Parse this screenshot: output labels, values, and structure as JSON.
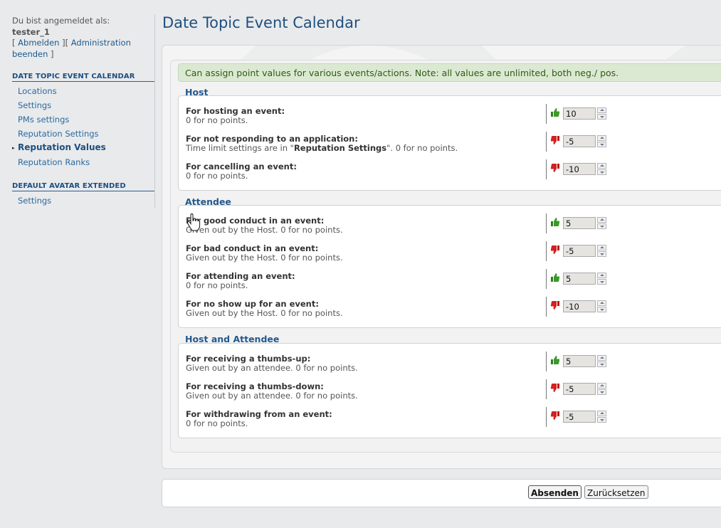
{
  "sidebar": {
    "logged_in_as": "Du bist angemeldet als:",
    "username": "tester_1",
    "link_logout": "Abmelden",
    "link_admin": "Administration",
    "link_admin_end": "beenden",
    "groups": [
      {
        "heading": "DATE TOPIC EVENT CALENDAR",
        "items": [
          {
            "label": "Locations",
            "active": false
          },
          {
            "label": "Settings",
            "active": false
          },
          {
            "label": "PMs settings",
            "active": false
          },
          {
            "label": "Reputation Settings",
            "active": false
          },
          {
            "label": "Reputation Values",
            "active": true
          },
          {
            "label": "Reputation Ranks",
            "active": false
          }
        ]
      },
      {
        "heading": "DEFAULT AVATAR EXTENDED",
        "items": [
          {
            "label": "Settings",
            "active": false
          }
        ]
      }
    ]
  },
  "page": {
    "title": "Date Topic Event Calendar",
    "info": "Can assign point values for various events/actions. Note: all values are unlimited, both neg./ pos."
  },
  "sections": [
    {
      "title": "Host",
      "rows": [
        {
          "label": "For hosting an event:",
          "desc": "0 for no points.",
          "thumb": "thumbs-up",
          "value": "10"
        },
        {
          "label": "For not responding to an application:",
          "desc_pre": "Time limit settings are in \"",
          "desc_bold": "Reputation Settings",
          "desc_post": "\". 0 for no points.",
          "thumb": "thumbs-down",
          "value": "-5"
        },
        {
          "label": "For cancelling an event:",
          "desc": "0 for no points.",
          "thumb": "thumbs-down",
          "value": "-10"
        }
      ]
    },
    {
      "title": "Attendee",
      "rows": [
        {
          "label": "For good conduct in an event:",
          "desc": "Given out by the Host. 0 for no points.",
          "thumb": "thumbs-up",
          "value": "5"
        },
        {
          "label": "For bad conduct in an event:",
          "desc": "Given out by the Host. 0 for no points.",
          "thumb": "thumbs-down",
          "value": "-5"
        },
        {
          "label": "For attending an event:",
          "desc": "0 for no points.",
          "thumb": "thumbs-up",
          "value": "5"
        },
        {
          "label": "For no show up for an event:",
          "desc": "Given out by the Host. 0 for no points.",
          "thumb": "thumbs-down",
          "value": "-10"
        }
      ]
    },
    {
      "title": "Host and Attendee",
      "rows": [
        {
          "label": "For receiving a thumbs-up:",
          "desc": "Given out by an attendee. 0 for no points.",
          "thumb": "thumbs-up",
          "value": "5"
        },
        {
          "label": "For receiving a thumbs-down:",
          "desc": "Given out by an attendee. 0 for no points.",
          "thumb": "thumbs-down",
          "value": "-5"
        },
        {
          "label": "For withdrawing from an event:",
          "desc": "0 for no points.",
          "thumb": "thumbs-down",
          "value": "-5"
        }
      ]
    }
  ],
  "buttons": {
    "submit": "Absenden",
    "reset": "Zurücksetzen"
  },
  "colors": {
    "accent": "#1e4f80",
    "info_bg": "#dbe9d2",
    "thumb_up": "#3a9a2a",
    "thumb_down": "#d42020"
  }
}
